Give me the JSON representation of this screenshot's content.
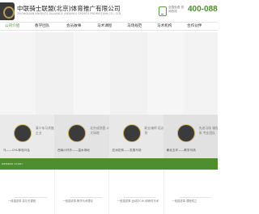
{
  "header": {
    "brand_cn": "中联骑士联盟(北京)体育推广有限公司",
    "brand_en": "ZHONGLIAN KNIGHTS ALLIANCE (BEIJING) SPORTS PROMOTION CO., LTD.",
    "hotline_label": "全国免费 咨询热线",
    "phone": "400-088"
  },
  "nav": [
    "公司介绍",
    "教学团队",
    "会员故事",
    "马术课程",
    "马场规范",
    "马术机构",
    "合作伙伴"
  ],
  "tiles": [
    {
      "text": "青少年马术推广企业",
      "caption": "马——CHU体验马会"
    },
    {
      "text": "北京成熟营 4个大场地",
      "caption": "西南六环外——温木场地"
    },
    {
      "text": "职业骑师 培训成熟",
      "caption": "亚洲花驹——发展马场"
    },
    {
      "text": "先进马场 课程体系 专业团队",
      "caption": "朝北五环——教学马场"
    }
  ],
  "section_label": "MEMBER STORY",
  "news": [
    "一段描述事 高尔夫课程",
    "一段描述事 教学马术理论",
    "一段描述事 运动中CHU训练时马术",
    "一段描述事 课程成立"
  ],
  "colors": {
    "accent": "#4d8f2e",
    "gold": "#c9a85a",
    "dark": "#3b3b3b"
  }
}
